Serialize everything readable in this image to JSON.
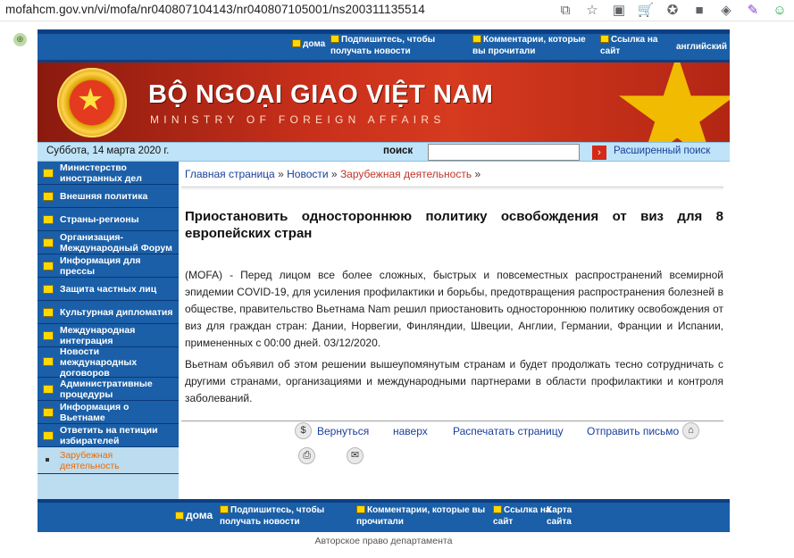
{
  "browser": {
    "url": "mofahcm.gov.vn/vi/mofa/nr040807104143/nr040807105001/ns200311135514",
    "icons": [
      "translate-icon",
      "star-icon",
      "extension-icon",
      "cart-icon",
      "bookmark-icon",
      "square-icon",
      "cube-icon",
      "feather-icon",
      "frog-icon"
    ]
  },
  "topnav": {
    "home": "дома",
    "subscribe": "Подпишитесь, чтобы получать новости",
    "comments": "Комментарии, которые вы прочитали",
    "link": "Ссылка на сайт",
    "english": "английский"
  },
  "banner": {
    "title": "BỘ NGOẠI GIAO VIỆT NAM",
    "subtitle": "MINISTRY OF FOREIGN AFFAIRS"
  },
  "searchbar": {
    "date": "Суббота, 14 марта 2020 г.",
    "label": "поиск",
    "input_value": "",
    "advanced": "Расширенный поиск"
  },
  "sidebar": {
    "items": [
      {
        "label": "Министерство иностранных дел"
      },
      {
        "label": "Внешняя политика"
      },
      {
        "label": "Страны-регионы"
      },
      {
        "label": "Организация-Международный Форум"
      },
      {
        "label": "Информация для прессы"
      },
      {
        "label": "Защита частных лиц"
      },
      {
        "label": "Культурная дипломатия"
      },
      {
        "label": "Международная интеграция"
      },
      {
        "label": "Новости международных договоров"
      },
      {
        "label": "Административные процедуры"
      },
      {
        "label": "Информация о Вьетнаме"
      },
      {
        "label": "Ответить на петиции избирателей"
      },
      {
        "label": "Зарубежная деятельность"
      }
    ]
  },
  "breadcrumb": {
    "home": "Главная страница",
    "news": "Новости",
    "current": "Зарубежная деятельность",
    "sep": "»"
  },
  "article": {
    "headline": "Приостановить одностороннюю политику освобождения от виз для 8 европейских стран",
    "para1": "(MOFA) - Перед лицом все более сложных, быстрых и повсеместных распространений всемирной эпидемии COVID-19, для усиления профилактики и борьбы, предотвращения распространения болезней в обществе, правительство Вьетнама Nam решил приостановить одностороннюю политику освобождения от виз для граждан стран: Дании, Норвегии, Финляндии, Швеции, Англии, Германии, Франции и Испании, примененных с 00:00 дней. 03/12/2020.",
    "para2": "Вьетнам объявил об этом решении вышеупомянутым странам и будет продолжать тесно сотрудничать с другими странами, организациями и международными партнерами в области профилактики и контроля заболеваний."
  },
  "tools": {
    "back": "Вернуться",
    "top": "наверх",
    "print": "Распечатать страницу",
    "send": "Отправить письмо"
  },
  "bottomnav": {
    "home": "дома",
    "subscribe": "Подпишитесь, чтобы получать новости",
    "comments": "Комментарии, которые вы прочитали",
    "link": "Ссылка на сайт",
    "sitemap": "Карта сайта"
  },
  "copyright": "Авторское право департамента"
}
